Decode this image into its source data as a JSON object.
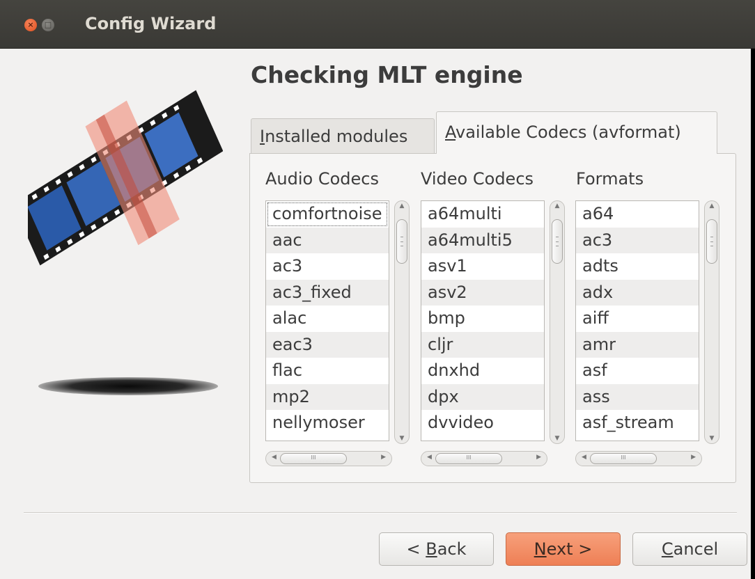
{
  "window": {
    "title": "Config Wizard",
    "close_glyph": "×",
    "max_glyph": "□"
  },
  "page": {
    "heading": "Checking MLT engine"
  },
  "tabs": {
    "installed": {
      "mnemonic": "I",
      "rest": "nstalled modules"
    },
    "available": {
      "mnemonic": "A",
      "rest": "vailable Codecs (avformat)"
    }
  },
  "columns": {
    "audio": {
      "label": "Audio Codecs",
      "items": [
        "comfortnoise",
        "aac",
        "ac3",
        "ac3_fixed",
        "alac",
        "eac3",
        "flac",
        "mp2",
        "nellymoser"
      ]
    },
    "video": {
      "label": "Video Codecs",
      "items": [
        "a64multi",
        "a64multi5",
        "asv1",
        "asv2",
        "bmp",
        "cljr",
        "dnxhd",
        "dpx",
        "dvvideo"
      ]
    },
    "formats": {
      "label": "Formats",
      "items": [
        "a64",
        "ac3",
        "adts",
        "adx",
        "aiff",
        "amr",
        "asf",
        "ass",
        "asf_stream"
      ]
    }
  },
  "scroll": {
    "up_glyph": "▲",
    "down_glyph": "▼",
    "left_glyph": "◀",
    "right_glyph": "▶",
    "thumb_grip": "III"
  },
  "buttons": {
    "back": {
      "prefix": "< ",
      "mnemonic": "B",
      "rest": "ack"
    },
    "next": {
      "mnemonic": "N",
      "rest": "ext >"
    },
    "cancel": {
      "mnemonic": "C",
      "rest": "ancel"
    }
  },
  "colors": {
    "accent": "#ee7f55",
    "titlebar": "#3f3e3a",
    "window_bg": "#f2f1f0"
  }
}
